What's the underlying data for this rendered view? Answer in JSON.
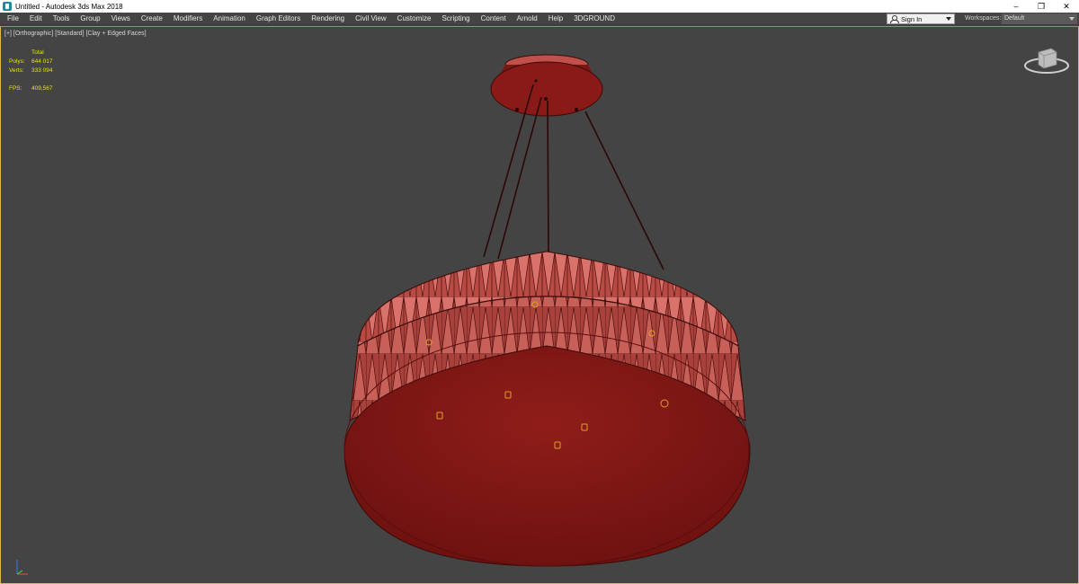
{
  "window": {
    "title": "Untitled - Autodesk 3ds Max 2018",
    "minimize": "–",
    "restore": "❐",
    "close": "✕"
  },
  "menu": {
    "items": [
      "File",
      "Edit",
      "Tools",
      "Group",
      "Views",
      "Create",
      "Modifiers",
      "Animation",
      "Graph Editors",
      "Rendering",
      "Civil View",
      "Customize",
      "Scripting",
      "Content",
      "Arnold",
      "Help",
      "3DGROUND"
    ],
    "signin_label": "Sign In",
    "workspaces_label": "Workspaces:",
    "workspace_value": "Default"
  },
  "viewport": {
    "label": "[+] [Orthographic] [Standard] [Clay + Edged Faces]",
    "stats": {
      "header": "Total",
      "polys_label": "Polys:",
      "polys_value": "644 017",
      "verts_label": "Verts:",
      "verts_value": "333 094",
      "fps_label": "FPS:",
      "fps_value": "409,567"
    }
  },
  "colors": {
    "viewport_bg": "#444444",
    "active_border": "#e3b542",
    "stats_text": "#e6e600",
    "model_fill": "#8a1a17",
    "model_light": "#c85a55"
  }
}
